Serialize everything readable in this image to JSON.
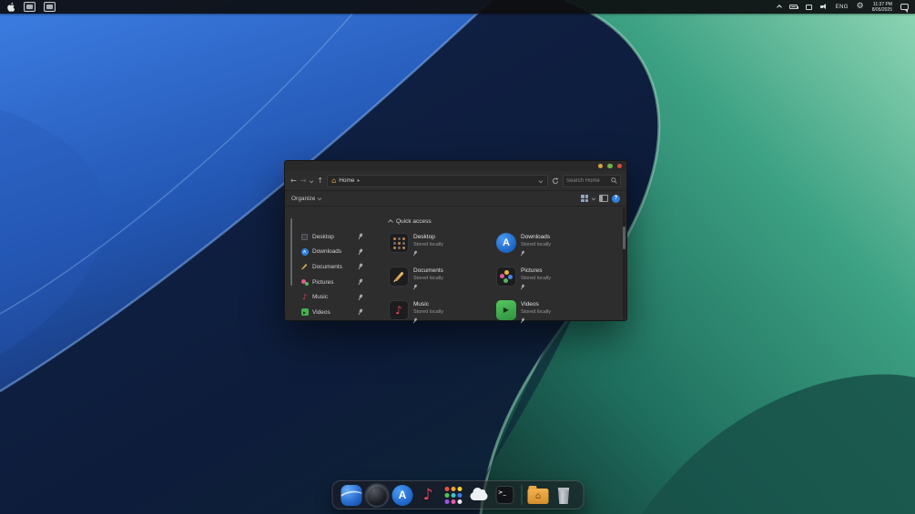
{
  "menubar": {
    "language": "ENG",
    "clock": {
      "time": "11:37 PM",
      "date": "8/05/2025"
    }
  },
  "explorer": {
    "nav": {
      "address_location": "Home",
      "search_placeholder": "Search Home"
    },
    "toolbar": {
      "organize_label": "Organize",
      "help_glyph": "?"
    },
    "section_title": "Quick access",
    "sidebar_items": [
      {
        "label": "Desktop"
      },
      {
        "label": "Downloads"
      },
      {
        "label": "Documents"
      },
      {
        "label": "Pictures"
      },
      {
        "label": "Music"
      },
      {
        "label": "Videos"
      }
    ],
    "tiles": [
      {
        "name": "Desktop",
        "status": "Stored locally"
      },
      {
        "name": "Downloads",
        "status": "Stored locally"
      },
      {
        "name": "Documents",
        "status": "Stored locally"
      },
      {
        "name": "Pictures",
        "status": "Stored locally"
      },
      {
        "name": "Music",
        "status": "Stored locally"
      },
      {
        "name": "Videos",
        "status": "Stored locally"
      }
    ]
  },
  "dock": {
    "items": [
      "files",
      "browser",
      "app-store",
      "music",
      "launchpad",
      "cloud",
      "terminal",
      "home-folder",
      "trash"
    ]
  },
  "glyphs": {
    "back_arrow": "←",
    "forward_arrow": "→",
    "up_arrow": "↑",
    "breadcrumb_arrow": "▸",
    "house": "⌂",
    "appstore_letter": "A",
    "music_note": "♪",
    "play": "▶",
    "terminal_prompt": ">_",
    "gear": "⚙"
  },
  "colors": {
    "accent_blue": "#2f80e0",
    "wallpaper_blue": "#2f6bd0",
    "wallpaper_teal": "#2f9077",
    "traffic_yellow": "#d9a23b",
    "traffic_green": "#71b347",
    "traffic_red": "#d8493c"
  }
}
